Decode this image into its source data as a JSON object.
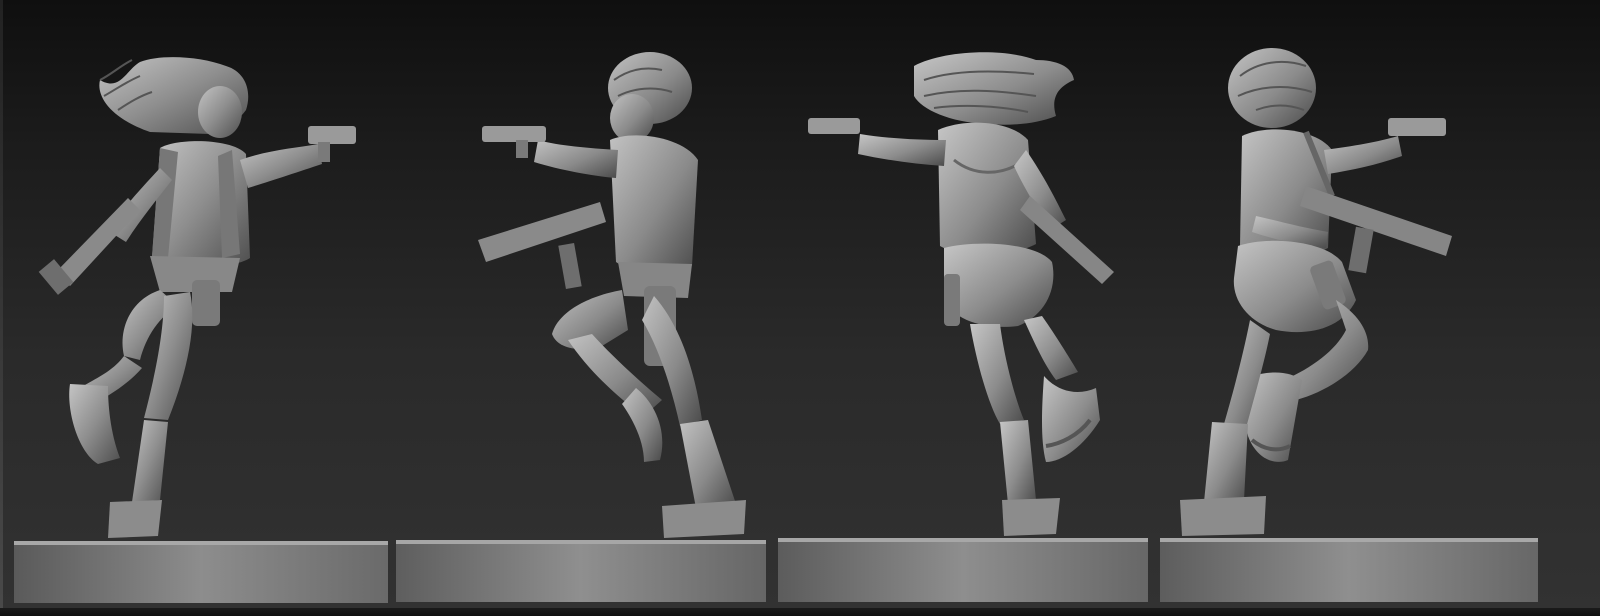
{
  "viewport": {
    "background_top": "#0f0f0f",
    "background_bottom": "#323232",
    "sculpt_color": "#8c8c8c",
    "sculpt_shadow": "#3a3a3a",
    "sculpt_highlight": "#c6c6c6"
  },
  "views": [
    {
      "view": "front-left",
      "figure": "miniature-figure-front"
    },
    {
      "view": "side-right",
      "figure": "miniature-figure-side"
    },
    {
      "view": "back",
      "figure": "miniature-figure-back"
    },
    {
      "view": "back-right",
      "figure": "miniature-figure-back-three-quarter"
    }
  ]
}
